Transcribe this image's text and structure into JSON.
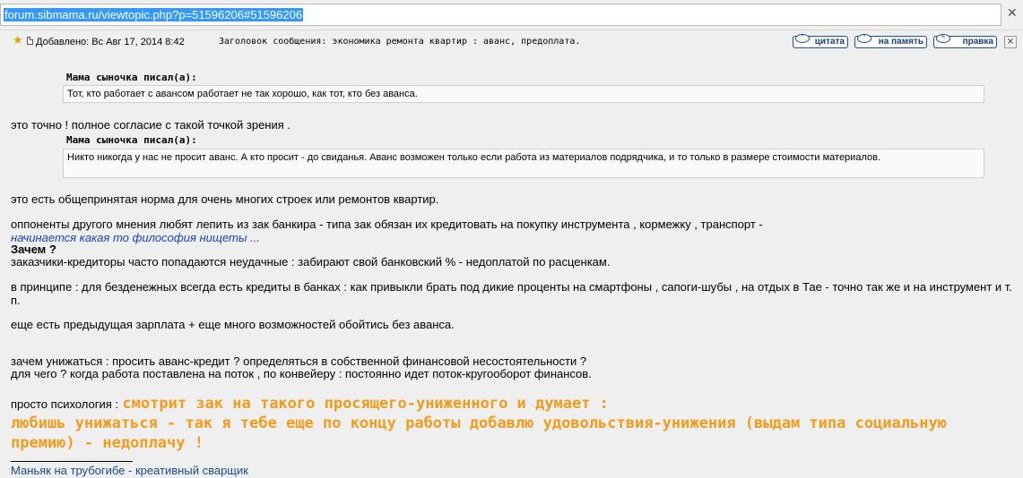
{
  "address_bar": {
    "url": "forum.sibmama.ru/viewtopic.php?p=51596206#51596206"
  },
  "post": {
    "posted": "Добавлено: Вс Авг 17, 2014 8:42",
    "subject": "Заголовок сообщения: экономика ремонта квартир : аванс, предоплата.",
    "buttons": {
      "quote": "цитата",
      "remember": "на память",
      "edit": "правка"
    },
    "quotes": [
      {
        "author": "Мама сыночка писал(а):",
        "text": "Тот, кто работает с авансом работает не так хорошо, как тот, кто без аванса."
      },
      {
        "author": "Мама сыночка писал(а):",
        "text": "Никто никогда у нас не просит аванс. А кто просит - до свиданья. Аванс возможен только если работа из материалов подрядчика, и то только в размере стоимости материалов."
      }
    ],
    "reply_after_quote1": "это точно ! полное согласие с такой точкой зрения .",
    "line_norm": "это есть общепринятая норма для очень многих строек или ремонтов квартир.",
    "line_opponents": "оппоненты другого мнения любят лепить из зак банкира - типа зак обязан их кредитовать на покупку инструмента , кормежку , транспорт -",
    "line_philosophy": "начинается какая то философия нищеты ...",
    "line_why": "Зачем ?",
    "line_creditors": "заказчики-кредиторы часто попадаются неудачные : забирают свой банковский % - недоплатой по расценкам.",
    "line_principle": "в принципе : для безденежных всегда есть кредиты в банках : как привыкли брать под дикие проценты на смартфоны , сапоги-шубы , на отдых в Тае - точно так же и на инструмент и т. п.",
    "line_salary": "еще есть предыдущая зарплата + еще много возможностей обойтись без аванса.",
    "line_humiliate": "зачем унижаться : просить аванс-кредит ? определяться в собственной финансовой несостоятельности ?",
    "line_flow": "для чего ? когда работа поставлена на поток , по конвейеру : постоянно идет поток-кругооборот финансов.",
    "psych_prefix": "просто психология :",
    "psych_orange_1": "смотрит зак на такого просящего-униженного и думает :",
    "psych_orange_2": "любишь унижаться - так я тебе еще по концу работы добавлю удовольствия-унижения (выдам типа социальную премию) - недоплачу !",
    "signature": "Маньяк на трубогибе - креативный сварщик"
  },
  "colors": {
    "highlight": "#3399ff",
    "orange_text": "#f39b1a",
    "link": "#1a3fc2",
    "background": "#efefef"
  }
}
